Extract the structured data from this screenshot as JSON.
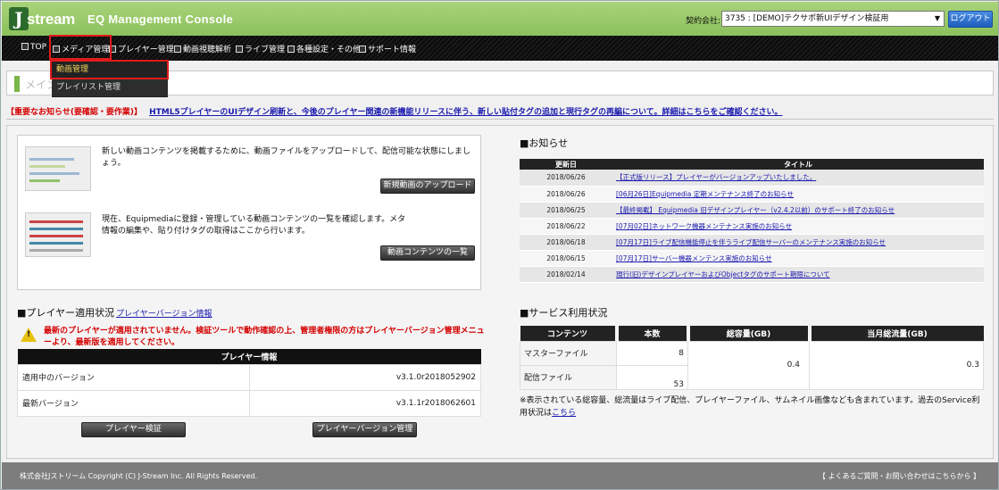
{
  "header": {
    "logo_j": "J",
    "logo_rest": "stream",
    "title": "EQ Management Console",
    "contract_label": "契約会社:",
    "contract_value": "3735 : [DEMO]テクサポ新UIデザイン検証用",
    "logout_label": "ログアウト"
  },
  "nav": {
    "items": [
      {
        "label": "TOP"
      },
      {
        "label": "メディア管理"
      },
      {
        "label": "プレイヤー管理"
      },
      {
        "label": "動画視聴解析"
      },
      {
        "label": "ライブ管理"
      },
      {
        "label": "各種設定・その他"
      },
      {
        "label": "サポート情報"
      }
    ],
    "dropdown": [
      {
        "label": "動画管理"
      },
      {
        "label": "プレイリスト管理"
      }
    ]
  },
  "page_title": "メイン",
  "notice": {
    "tag": "【重要なお知らせ(要確認・要作業)】",
    "link": "HTML5プレイヤーのUIデザイン刷新と、今後のプレイヤー関連の新機能リリースに伴う、新しい貼付タグの追加と現行タグの再編について。詳細はこちらをご確認ください。"
  },
  "actions": {
    "upload_desc": "新しい動画コンテンツを掲載するために、動画ファイルをアップロードして、配信可能な状態にしましょう。",
    "upload_btn": "新規動画のアップロード",
    "list_desc": "現在、Equipmediaに登録・管理している動画コンテンツの一覧を確認します。メタ情報の編集や、貼り付けタグの取得はここから行います。",
    "list_btn": "動画コンテンツの一覧"
  },
  "news": {
    "heading": "■お知らせ",
    "col_date": "更新日",
    "col_title": "タイトル",
    "rows": [
      {
        "date": "2018/06/26",
        "title": "【正式版リリース】プレイヤーがバージョンアップいたしました。"
      },
      {
        "date": "2018/06/26",
        "title": "[06月26日]Equipmedia 定期メンテナンス終了のお知らせ"
      },
      {
        "date": "2018/06/25",
        "title": "【最終掲載】 Equipmedia 旧デザインプレイヤー（v2.4.2以前）のサポート終了のお知らせ"
      },
      {
        "date": "2018/06/22",
        "title": "[07月02日]ネットワーク機器メンテナンス実施のお知らせ"
      },
      {
        "date": "2018/06/18",
        "title": "[07月17日]ライブ配信機能停止を伴うライブ配信サーバーのメンテナンス実施のお知らせ"
      },
      {
        "date": "2018/06/15",
        "title": "[07月17日]サーバー機器メンテンス実施のお知らせ"
      },
      {
        "date": "2018/02/14",
        "title": "現行(旧)デザインプレイヤーおよびObjectタグのサポート期限について"
      }
    ]
  },
  "player": {
    "heading": "■プレイヤー適用状況",
    "heading_link": "プレイヤーバージョン情報",
    "warning": "最新のプレイヤーが適用されていません。検証ツールで動作確認の上、管理者権限の方はプレイヤーバージョン管理メニューより、最新版を適用してください。",
    "table_title": "プレイヤー情報",
    "rows": [
      {
        "label": "適用中のバージョン",
        "value": "v3.1.0r2018052902"
      },
      {
        "label": "最新バージョン",
        "value": "v3.1.1r2018062601"
      }
    ],
    "verify_btn": "プレイヤー検証",
    "manage_btn": "プレイヤーバージョン管理"
  },
  "service": {
    "heading": "■サービス利用状況",
    "col_content": "コンテンツ",
    "col_count": "本数",
    "col_capacity": "総容量(GB)",
    "col_traffic": "当月総流量(GB)",
    "master_label": "マスターファイル",
    "master_count": "8",
    "delivery_label": "配信ファイル",
    "delivery_count": "53",
    "capacity": "0.4",
    "traffic": "0.3",
    "note": "※表示されている総容量、総流量はライブ配信、プレイヤーファイル、サムネイル画像なども含まれています。過去のService利用状況は",
    "note_link": "こちら"
  },
  "footer": {
    "copyright": "株式会社Jストリーム Copyright (C) J-Stream Inc. All Rights Reserved.",
    "faq": "【 よくあるご質問・お問い合わせはこちらから 】"
  }
}
